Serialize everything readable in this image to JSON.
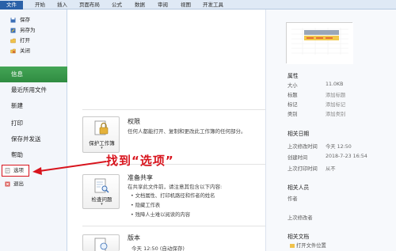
{
  "ribbon": {
    "file_tab": "文件",
    "tabs": [
      "开始",
      "插入",
      "页面布局",
      "公式",
      "数据",
      "审阅",
      "视图",
      "开发工具"
    ]
  },
  "sidebar": {
    "quick_items": [
      {
        "label": "保存",
        "icon": "save-icon"
      },
      {
        "label": "另存为",
        "icon": "save-as-icon"
      },
      {
        "label": "打开",
        "icon": "open-folder-icon"
      },
      {
        "label": "关闭",
        "icon": "close-file-icon"
      }
    ],
    "items": [
      {
        "label": "信息",
        "active": true
      },
      {
        "label": "最近所用文件",
        "active": false
      },
      {
        "label": "新建",
        "active": false
      },
      {
        "label": "打印",
        "active": false
      },
      {
        "label": "保存并发送",
        "active": false
      },
      {
        "label": "帮助",
        "active": false
      }
    ],
    "bottom_items": [
      {
        "label": "选项",
        "icon": "options-icon"
      },
      {
        "label": "退出",
        "icon": "exit-icon"
      }
    ]
  },
  "info": {
    "permissions": {
      "button_label": "保护工作簿",
      "title": "权限",
      "description": "任何人都能打开、复制和更改此工作簿的任何部分。"
    },
    "prepare": {
      "button_label": "检查问题",
      "title": "准备共享",
      "description": "在共享此文件前，请注意其包含以下内容:",
      "bullets": [
        "文档属性、打印机路径和作者的姓名",
        "隐藏工作表",
        "残障人士难以阅读的内容"
      ]
    },
    "versions": {
      "title": "版本",
      "partial_text": "今天 12:50 (自动保存)"
    }
  },
  "annotation": {
    "text": "找到“选项”",
    "color": "#d8141d"
  },
  "properties": {
    "header": "属性",
    "rows": [
      {
        "label": "大小",
        "value": "11.0KB",
        "link": false
      },
      {
        "label": "标题",
        "value": "添加标题",
        "link": true
      },
      {
        "label": "标记",
        "value": "添加标记",
        "link": true
      },
      {
        "label": "类别",
        "value": "添加类别",
        "link": true
      }
    ],
    "dates_header": "相关日期",
    "dates": [
      {
        "label": "上次修改时间",
        "value": "今天 12:50"
      },
      {
        "label": "创建时间",
        "value": "2018-7-23 16:54"
      },
      {
        "label": "上次打印时间",
        "value": "从不"
      }
    ],
    "people_header": "相关人员",
    "people": [
      {
        "label": "作者",
        "value": ""
      },
      {
        "label": "上次修改者",
        "value": ""
      }
    ],
    "docs_header": "相关文档",
    "docs_link": "打开文件位置"
  },
  "colors": {
    "active_green": "#3a9a4c",
    "file_blue": "#2a61a8",
    "annotation_red": "#d8141d"
  }
}
